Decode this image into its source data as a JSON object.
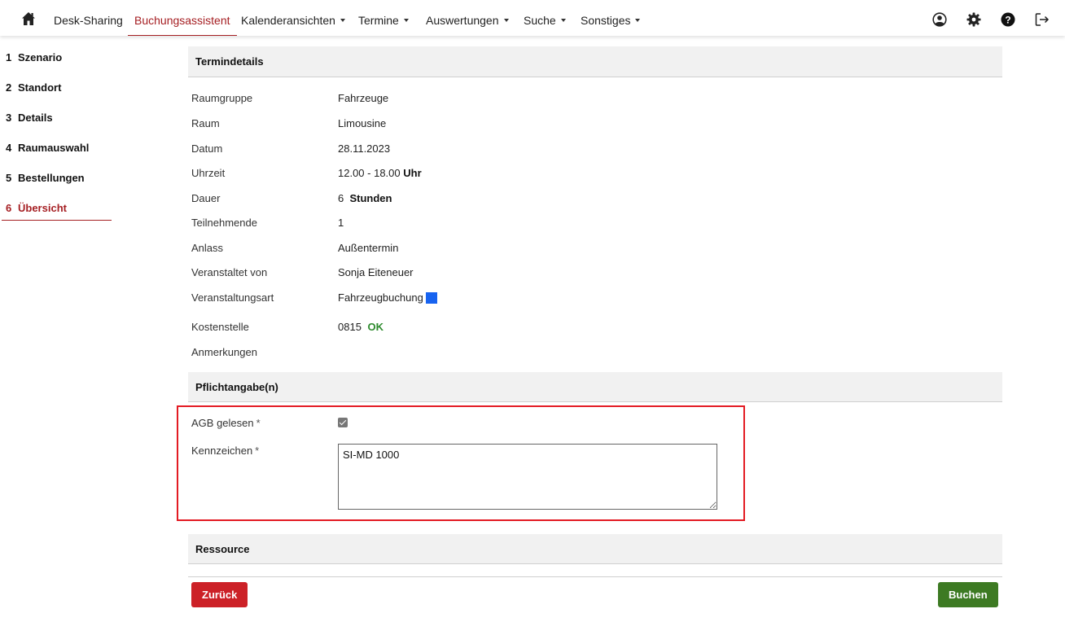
{
  "navbar": {
    "items": [
      {
        "label": "Desk-Sharing",
        "dropdown": false
      },
      {
        "label": "Buchungsassistent",
        "dropdown": false,
        "active": true
      },
      {
        "label": "Kalenderansichten",
        "dropdown": true
      },
      {
        "label": "Termine",
        "dropdown": true
      },
      {
        "label": "Auswertungen",
        "dropdown": true
      },
      {
        "label": "Suche",
        "dropdown": true
      },
      {
        "label": "Sonstiges",
        "dropdown": true
      }
    ],
    "icons": [
      "home-icon",
      "user-circle-icon",
      "gear-icon",
      "help-icon",
      "logout-icon"
    ]
  },
  "steps": [
    {
      "num": "1",
      "label": "Szenario"
    },
    {
      "num": "2",
      "label": "Standort"
    },
    {
      "num": "3",
      "label": "Details"
    },
    {
      "num": "4",
      "label": "Raumauswahl"
    },
    {
      "num": "5",
      "label": "Bestellungen"
    },
    {
      "num": "6",
      "label": "Übersicht",
      "active": true
    }
  ],
  "termindetails": {
    "title": "Termindetails",
    "raumgruppe": {
      "label": "Raumgruppe",
      "value": "Fahrzeuge"
    },
    "raum": {
      "label": "Raum",
      "value": "Limousine"
    },
    "datum": {
      "label": "Datum",
      "value": "28.11.2023"
    },
    "uhrzeit": {
      "label": "Uhrzeit",
      "value": "12.00 - 18.00",
      "unit": "Uhr"
    },
    "dauer": {
      "label": "Dauer",
      "value": "6",
      "unit": "Stunden"
    },
    "teilnehmende": {
      "label": "Teilnehmende",
      "value": "1"
    },
    "anlass": {
      "label": "Anlass",
      "value": "Außentermin"
    },
    "veranstaltet": {
      "label": "Veranstaltet von",
      "value": "Sonja Eiteneuer"
    },
    "veranstaltungsart": {
      "label": "Veranstaltungsart",
      "value": "Fahrzeugbuchung",
      "color": "#1763f0"
    },
    "kostenstelle": {
      "label": "Kostenstelle",
      "value": "0815",
      "status": "OK"
    },
    "anmerkungen": {
      "label": "Anmerkungen",
      "value": ""
    }
  },
  "pflicht": {
    "title": "Pflichtangabe(n)",
    "agb": {
      "label": "AGB gelesen",
      "required": "*",
      "checked": true
    },
    "kennzeichen": {
      "label": "Kennzeichen",
      "required": "*",
      "value": "SI-MD 1000"
    }
  },
  "ressource": {
    "title": "Ressource"
  },
  "buttons": {
    "back": "Zurück",
    "book": "Buchen"
  },
  "colors": {
    "accent": "#a51e22",
    "back": "#cc2127",
    "book": "#3d7a23",
    "highlight": "#e31b23"
  }
}
